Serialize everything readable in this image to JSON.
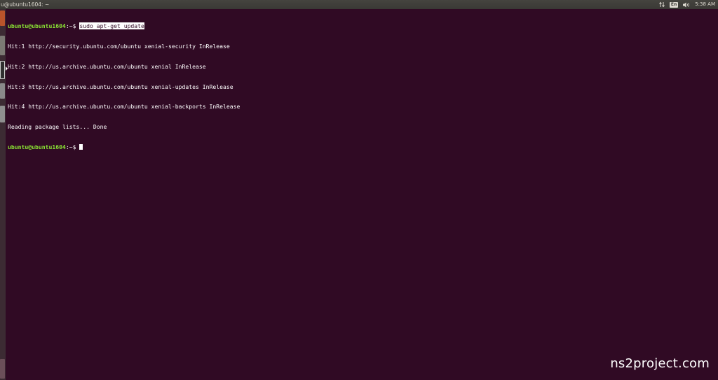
{
  "panel": {
    "window_title": "u@ubuntu1604: ~",
    "indicators": {
      "network_icon": "network-updown-icon",
      "keyboard_layout": "En",
      "volume_icon": "speaker-icon",
      "clock": "5:38 AM"
    }
  },
  "terminal": {
    "prompt_user_host": "ubuntu@ubuntu1604",
    "prompt_suffix": ":~$ ",
    "command": "sudo apt-get update",
    "output_lines": [
      "Hit:1 http://security.ubuntu.com/ubuntu xenial-security InRelease",
      "Hit:2 http://us.archive.ubuntu.com/ubuntu xenial InRelease",
      "Hit:3 http://us.archive.ubuntu.com/ubuntu xenial-updates InRelease",
      "Hit:4 http://us.archive.ubuntu.com/ubuntu xenial-backports InRelease",
      "Reading package lists... Done"
    ],
    "final_prompt_user_host": "ubuntu@ubuntu1604",
    "final_prompt_suffix": ":~$ "
  },
  "watermark": "ns2project.com",
  "colors": {
    "terminal_background": "#300a24",
    "prompt_green": "#8ae234",
    "panel_background": "#3a3935"
  }
}
